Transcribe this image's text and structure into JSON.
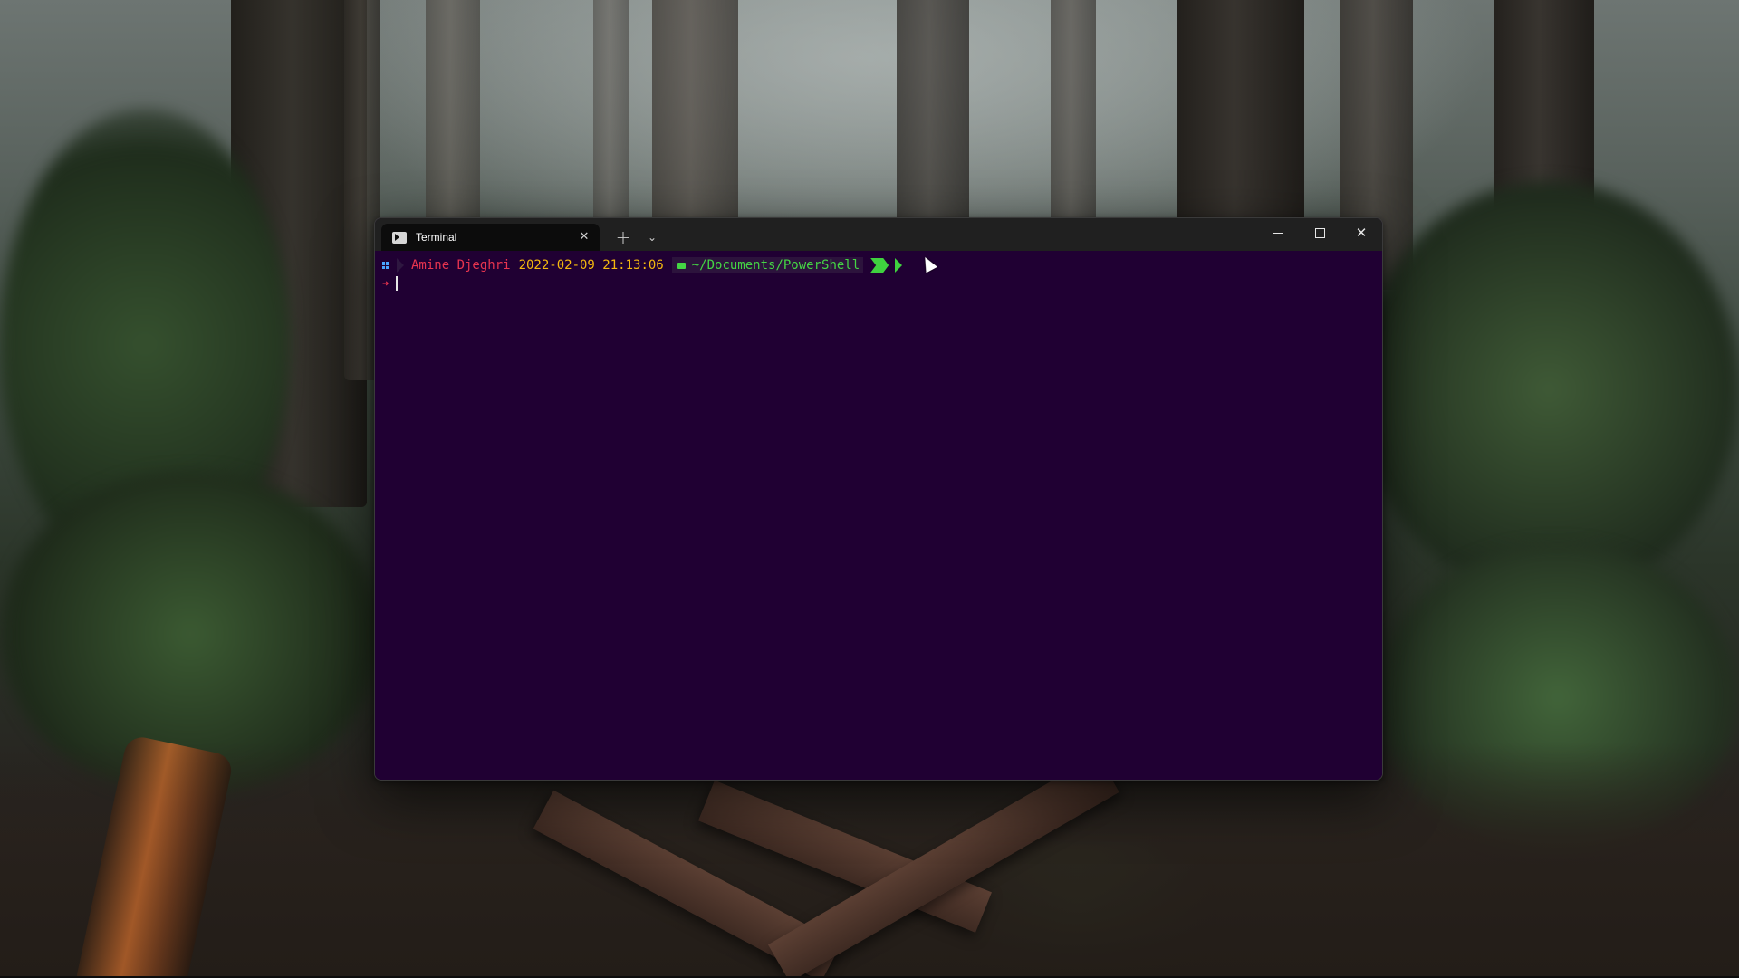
{
  "window": {
    "tab_title": "Terminal",
    "tab_close_icon": "✕",
    "new_tab_icon": "+",
    "dropdown_icon": "⌄",
    "close_icon": "✕"
  },
  "prompt": {
    "user": "Amine Djeghri",
    "datetime": "2022-02-09 21:13:06",
    "path": "~/Documents/PowerShell",
    "input_char": "➜",
    "input_value": ""
  },
  "colors": {
    "terminal_background": "#200033",
    "user": "#e8344f",
    "datetime": "#f5b90f",
    "path": "#44d544",
    "titlebar": "#202020"
  },
  "icons": {
    "tab": "powershell-icon",
    "os": "windows-icon",
    "path": "folder-icon",
    "git": "git-status-icon"
  }
}
